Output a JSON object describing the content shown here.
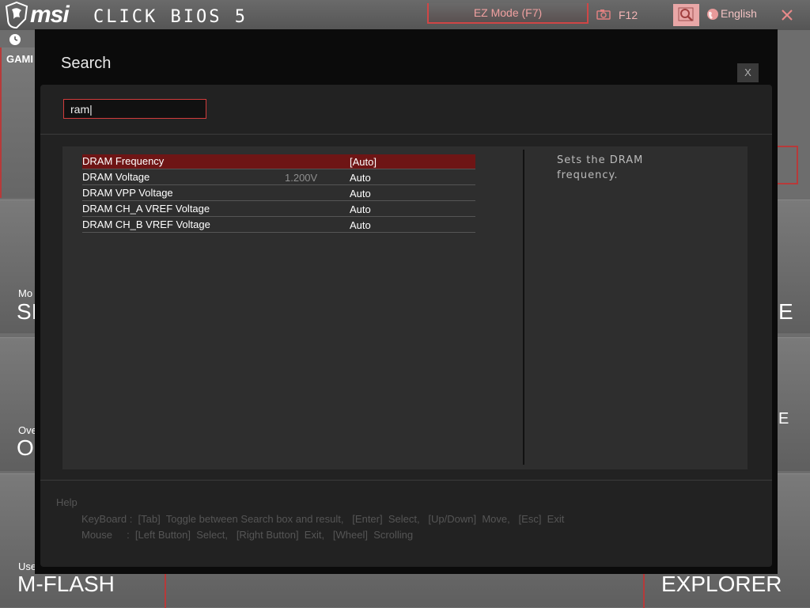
{
  "header": {
    "brand": "msi",
    "product": "CLICK BIOS 5",
    "ez_mode": "EZ Mode (F7)",
    "screenshot_key": "F12",
    "language": "English"
  },
  "background": {
    "gaming_label": "GAMI",
    "band_small_1": "Mo",
    "band_big_1": "SI",
    "band_big_1_right": "E",
    "band_small_2": "Ove",
    "band_big_2": "O",
    "band_big_2_right": "E",
    "band_small_3": "Use",
    "mflash": "M-FLASH",
    "explorer": "EXPLORER"
  },
  "dialog": {
    "title": "Search",
    "close_label": "X",
    "search_value": "ram|",
    "results": [
      {
        "name": "DRAM Frequency",
        "current": "",
        "value": "[Auto]",
        "selected": true
      },
      {
        "name": "DRAM Voltage",
        "current": "1.200V",
        "value": "Auto",
        "selected": false
      },
      {
        "name": "DRAM VPP Voltage",
        "current": "",
        "value": "Auto",
        "selected": false
      },
      {
        "name": "DRAM CH_A VREF Voltage",
        "current": "",
        "value": "Auto",
        "selected": false
      },
      {
        "name": "DRAM CH_B VREF Voltage",
        "current": "",
        "value": "Auto",
        "selected": false
      }
    ],
    "description": "Sets the DRAM frequency.",
    "help": {
      "title": "Help",
      "keyboard": "KeyBoard :  [Tab]  Toggle between Search box and result,   [Enter]  Select,   [Up/Down]  Move,   [Esc]  Exit",
      "mouse": "Mouse     :  [Left Button]  Select,   [Right Button]  Exit,   [Wheel]  Scrolling"
    }
  },
  "colors": {
    "accent": "#d23c3c",
    "selected_row": "#6e1515",
    "modal_bg": "#0b0b0b"
  }
}
